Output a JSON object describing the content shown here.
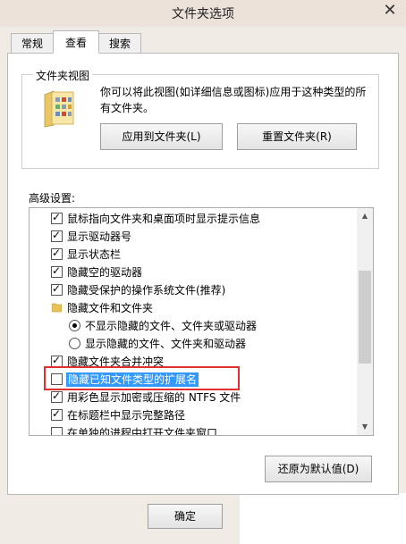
{
  "window": {
    "title": "文件夹选项",
    "close_icon": "✕"
  },
  "tabs": [
    {
      "label": "常规",
      "active": false
    },
    {
      "label": "查看",
      "active": true
    },
    {
      "label": "搜索",
      "active": false
    }
  ],
  "folder_views": {
    "title": "文件夹视图",
    "description": "你可以将此视图(如详细信息或图标)应用于这种类型的所有文件夹。",
    "apply_button": "应用到文件夹(L)",
    "reset_button": "重置文件夹(R)"
  },
  "advanced": {
    "label": "高级设置:",
    "items": [
      {
        "type": "checkbox",
        "checked": true,
        "label": "鼠标指向文件夹和桌面项时显示提示信息"
      },
      {
        "type": "checkbox",
        "checked": true,
        "label": "显示驱动器号"
      },
      {
        "type": "checkbox",
        "checked": true,
        "label": "显示状态栏"
      },
      {
        "type": "checkbox",
        "checked": true,
        "label": "隐藏空的驱动器"
      },
      {
        "type": "checkbox",
        "checked": true,
        "label": "隐藏受保护的操作系统文件(推荐)"
      },
      {
        "type": "folder",
        "label": "隐藏文件和文件夹"
      },
      {
        "type": "radio",
        "checked": true,
        "label": "不显示隐藏的文件、文件夹或驱动器"
      },
      {
        "type": "radio",
        "checked": false,
        "label": "显示隐藏的文件、文件夹和驱动器"
      },
      {
        "type": "checkbox",
        "checked": true,
        "label": "隐藏文件夹合并冲突"
      },
      {
        "type": "checkbox",
        "checked": false,
        "label": "隐藏已知文件类型的扩展名",
        "selected": true
      },
      {
        "type": "checkbox",
        "checked": true,
        "label": "用彩色显示加密或压缩的 NTFS 文件"
      },
      {
        "type": "checkbox",
        "checked": true,
        "label": "在标题栏中显示完整路径"
      },
      {
        "type": "checkbox",
        "checked": false,
        "label": "在单独的进程中打开文件夹窗口"
      }
    ]
  },
  "restore_defaults_button": "还原为默认值(D)",
  "ok_button": "确定",
  "colors": {
    "highlight": "#3399ff",
    "annotation_box": "#e0302f"
  }
}
